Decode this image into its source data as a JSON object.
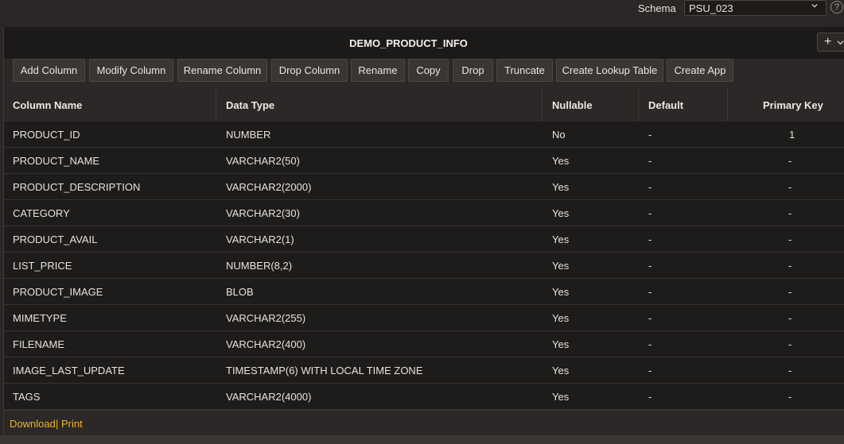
{
  "schema": {
    "label": "Schema",
    "value": "PSU_023"
  },
  "help": {
    "glyph": "?"
  },
  "panel": {
    "title": "DEMO_PRODUCT_INFO",
    "add_glyph": "+"
  },
  "toolbar": {
    "buttons": [
      "Add Column",
      "Modify Column",
      "Rename Column",
      "Drop Column",
      "Rename",
      "Copy",
      "Drop",
      "Truncate",
      "Create Lookup Table",
      "Create App"
    ]
  },
  "table": {
    "headers": [
      "Column Name",
      "Data Type",
      "Nullable",
      "Default",
      "Primary Key"
    ],
    "rows": [
      [
        "PRODUCT_ID",
        "NUMBER",
        "No",
        "-",
        "1"
      ],
      [
        "PRODUCT_NAME",
        "VARCHAR2(50)",
        "Yes",
        "-",
        "-"
      ],
      [
        "PRODUCT_DESCRIPTION",
        "VARCHAR2(2000)",
        "Yes",
        "-",
        "-"
      ],
      [
        "CATEGORY",
        "VARCHAR2(30)",
        "Yes",
        "-",
        "-"
      ],
      [
        "PRODUCT_AVAIL",
        "VARCHAR2(1)",
        "Yes",
        "-",
        "-"
      ],
      [
        "LIST_PRICE",
        "NUMBER(8,2)",
        "Yes",
        "-",
        "-"
      ],
      [
        "PRODUCT_IMAGE",
        "BLOB",
        "Yes",
        "-",
        "-"
      ],
      [
        "MIMETYPE",
        "VARCHAR2(255)",
        "Yes",
        "-",
        "-"
      ],
      [
        "FILENAME",
        "VARCHAR2(400)",
        "Yes",
        "-",
        "-"
      ],
      [
        "IMAGE_LAST_UPDATE",
        "TIMESTAMP(6) WITH LOCAL TIME ZONE",
        "Yes",
        "-",
        "-"
      ],
      [
        "TAGS",
        "VARCHAR2(4000)",
        "Yes",
        "-",
        "-"
      ]
    ]
  },
  "footer": {
    "download": "Download",
    "separator": "|",
    "print": "Print"
  },
  "colors": {
    "accent_link": "#f0b429",
    "background": "#1e1c1b"
  }
}
